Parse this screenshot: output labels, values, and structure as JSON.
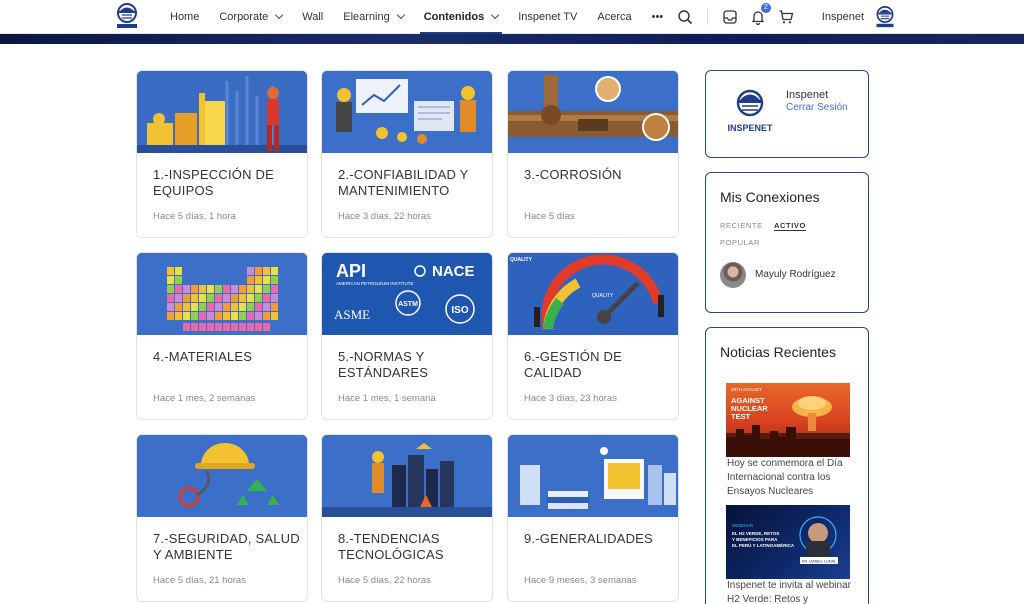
{
  "nav": {
    "logo_icon": "inspenet-logo-icon",
    "items": [
      {
        "label": "Home",
        "dropdown": false,
        "active": false
      },
      {
        "label": "Corporate",
        "dropdown": true,
        "active": false
      },
      {
        "label": "Wall",
        "dropdown": false,
        "active": false
      },
      {
        "label": "Elearning",
        "dropdown": true,
        "active": false
      },
      {
        "label": "Contenidos",
        "dropdown": true,
        "active": true
      },
      {
        "label": "Inspenet TV",
        "dropdown": false,
        "active": false
      },
      {
        "label": "Acerca",
        "dropdown": false,
        "active": false
      },
      {
        "label": "•••",
        "dropdown": false,
        "active": false
      }
    ],
    "icons": [
      "search-icon",
      "inbox-icon",
      "notification-bell-icon",
      "cart-icon"
    ],
    "notification_count": "2",
    "user_name": "Inspenet"
  },
  "cards": [
    {
      "title": "1.-Inspección de equipos",
      "time": "Hace 5 días, 1 hora",
      "image": "industrial-plant-inspector"
    },
    {
      "title": "2.-Confiabilidad y Mantenimiento",
      "time": "Hace 3 días, 22 horas",
      "image": "engineers-maintenance"
    },
    {
      "title": "3.-Corrosión",
      "time": "Hace 5 días",
      "image": "corroded-pipes"
    },
    {
      "title": "4.-Materiales",
      "time": "Hace 1 mes, 2 semanas",
      "image": "periodic-table"
    },
    {
      "title": "5.-Normas y Estándares",
      "time": "Hace 1 mes, 1 semana",
      "image": "standards-logos"
    },
    {
      "title": "6.-Gestión de Calidad",
      "time": "Hace 3 días, 23 horas",
      "image": "quality-gauge"
    },
    {
      "title": "7.-Seguridad, Salud y Ambiente",
      "time": "Hace 5 días, 21 horas",
      "image": "helmet-recycle"
    },
    {
      "title": "8.-Tendencias Tecnológicas",
      "time": "Hace 5 días, 22 horas",
      "image": "tech-city"
    },
    {
      "title": "9.-Generalidades",
      "time": "Hace 9 meses, 3 semanas",
      "image": "city-books"
    }
  ],
  "card_images": {
    "nace": "NACE",
    "api": "API",
    "api_sub": "AMERICAN PETROLEUM INSTITUTE",
    "asme": "ASME",
    "astm": "ASTM",
    "iso": "ISO",
    "quality_banner": "QUALITY",
    "quality_gauge": "QUALITY"
  },
  "profile": {
    "name": "Inspenet",
    "logout": "Cerrar Sesión",
    "logo_label": "INSPENET"
  },
  "connections": {
    "title": "Mis Conexiones",
    "tabs": [
      {
        "label": "RECIENTE",
        "active": false
      },
      {
        "label": "ACTIVO",
        "active": true
      },
      {
        "label": "POPULAR",
        "active": false
      }
    ],
    "members": [
      {
        "name": "Mayuly Rodríguez"
      }
    ]
  },
  "news": {
    "title": "Noticias Recientes",
    "items": [
      {
        "text": "Hoy se conmemora el Día Internacional contra los Ensayos Nucleares",
        "image_heading": "29TH AUGUST",
        "image_lines": [
          "AGAINST",
          "NUCLEAR",
          "TEST"
        ]
      },
      {
        "text": "Inspenet te invita al webinar H2 Verde: Retos y",
        "image_heading": "WEBINAR",
        "image_lines": [
          "EL H2 VERDE, RETOS",
          "Y BENEFICIOS PARA",
          "EL PERÚ Y LATINOAMÉRICA"
        ],
        "image_speaker": "DR. DANIEL LUNAL"
      }
    ]
  },
  "colors": {
    "brand_blue": "#1f3c88",
    "card_image_blue": "#2f5fb4",
    "panel_border": "#2a4a8a",
    "link": "#3f6fd8"
  }
}
